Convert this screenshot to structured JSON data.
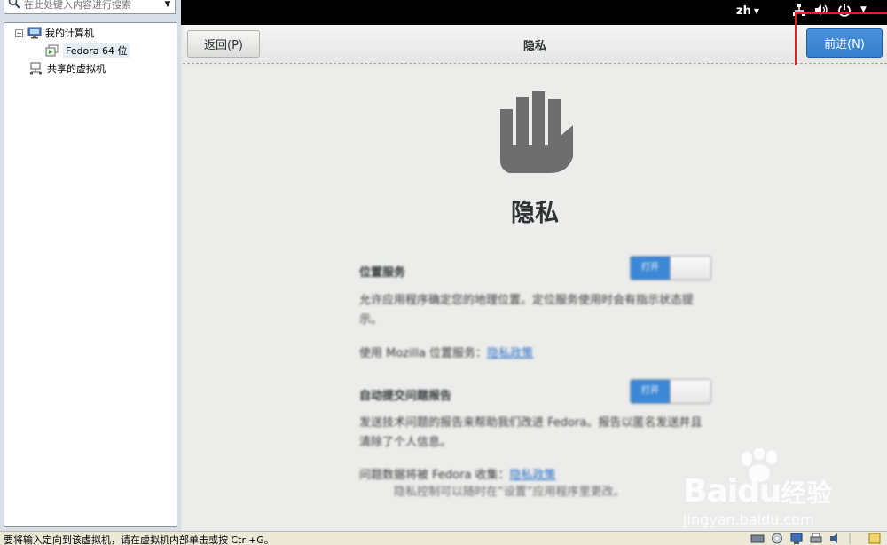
{
  "library": {
    "search_placeholder": "在此处键入内容进行搜索",
    "tree": {
      "my_computer": "我的计算机",
      "vm_name": "Fedora 64 位",
      "shared_vms": "共享的虚拟机"
    }
  },
  "guest": {
    "topbar": {
      "lang": "zh"
    },
    "headerbar": {
      "back_label": "返回(P)",
      "title": "隐私",
      "next_label": "前进(N)"
    },
    "page": {
      "heading": "隐私",
      "location": {
        "title": "位置服务",
        "switch_label": "打开",
        "description": "允许应用程序确定您的地理位置。定位服务使用时会有指示状态提示。",
        "link_prefix": "使用 Mozilla 位置服务：",
        "link_text": "隐私政策"
      },
      "reporting": {
        "title": "自动提交问题报告",
        "switch_label": "打开",
        "description": "发送技术问题的报告来帮助我们改进 Fedora。报告以匿名发送并且清除了个人信息。",
        "link_prefix": "问题数据将被 Fedora 收集：",
        "link_text": "隐私政策"
      },
      "footnote": "隐私控制可以随时在“设置”应用程序里更改。"
    }
  },
  "watermark": {
    "brand_latin": "Bai",
    "brand_latin2": "du",
    "brand_cn": "经验",
    "url": "jingyan.baidu.com"
  },
  "statusbar": {
    "message": "要将输入定向到该虚拟机，请在虚拟机内部单击或按 Ctrl+G。"
  },
  "colors": {
    "accent_blue": "#3c87d6",
    "highlight_red": "#e02020",
    "guest_topbar": "#000000"
  },
  "icons": [
    "search-icon",
    "dropdown-arrow-icon",
    "computer-icon",
    "vm-icon",
    "shared-vm-icon",
    "network-icon",
    "volume-icon",
    "power-icon",
    "hand-privacy-icon",
    "paw-icon"
  ]
}
